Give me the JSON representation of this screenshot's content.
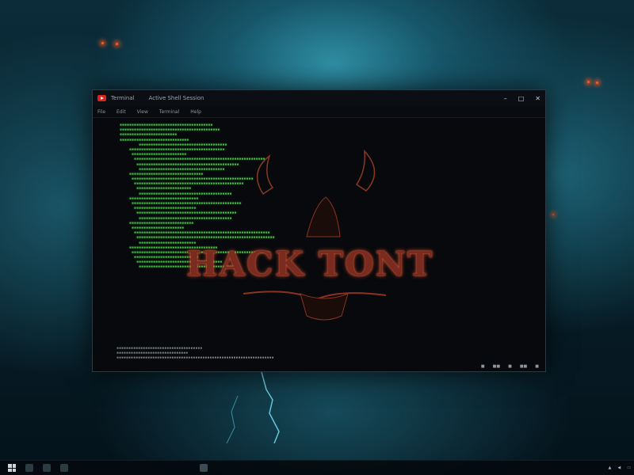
{
  "window": {
    "title_segments": [
      "Terminal",
      "Active Shell Session"
    ],
    "menu_items": [
      "File",
      "Edit",
      "View",
      "Terminal",
      "Help"
    ],
    "controls": {
      "minimize": "–",
      "maximize": "□",
      "close": "✕"
    }
  },
  "terminal": {
    "logo_text": "HACK TONT",
    "line_count": 30,
    "footer_line_count": 8
  },
  "taskbar": {
    "clock_line1": "",
    "clock_line2": ""
  },
  "colors": {
    "terminal_text": "#4fd44f",
    "logo": "#c8452a",
    "accent": "#d8241c"
  },
  "icons": [
    "app-icon",
    "start-icon",
    "search-icon",
    "taskview-icon",
    "files-icon",
    "terminal-icon",
    "network-icon",
    "volume-icon",
    "notification-icon"
  ]
}
